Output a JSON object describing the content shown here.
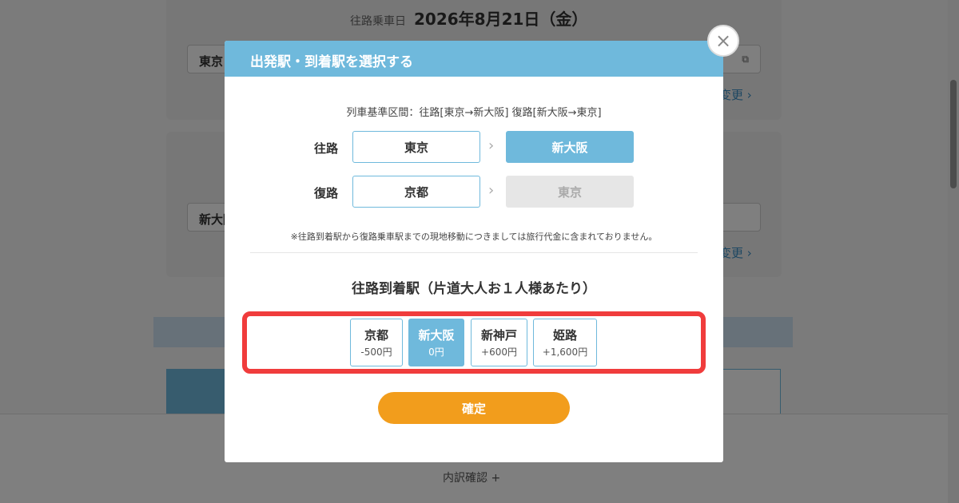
{
  "background": {
    "outbound_date_label": "往路乗車日",
    "outbound_date_value": "2026年8月21日（金）",
    "outbound_station": "東京",
    "return_station": "新大阪",
    "change_label": "変更",
    "breakdown_label": "内訳確認 +"
  },
  "modal": {
    "title": "出発駅・到着駅を選択する",
    "close_symbol": "×",
    "route_note": "列車基準区間：往路[東京→新大阪] 復路[新大阪→東京]",
    "outbound": {
      "label": "往路",
      "from": "東京",
      "to": "新大阪"
    },
    "return": {
      "label": "復路",
      "from": "京都",
      "to": "東京"
    },
    "notice": "※往路到着駅から復路乗車駅までの現地移動につきましては旅行代金に含まれておりません。",
    "section_title": "往路到着駅（片道大人お１人様あたり）",
    "options": [
      {
        "name": "京都",
        "price": "-500円",
        "selected": false
      },
      {
        "name": "新大阪",
        "price": "0円",
        "selected": true
      },
      {
        "name": "新神戸",
        "price": "+600円",
        "selected": false
      },
      {
        "name": "姫路",
        "price": "+1,600円",
        "selected": false
      }
    ],
    "confirm_label": "確定"
  },
  "colors": {
    "accent": "#6fb9dc",
    "confirm": "#f29d1c",
    "highlight": "#f03c3c"
  }
}
